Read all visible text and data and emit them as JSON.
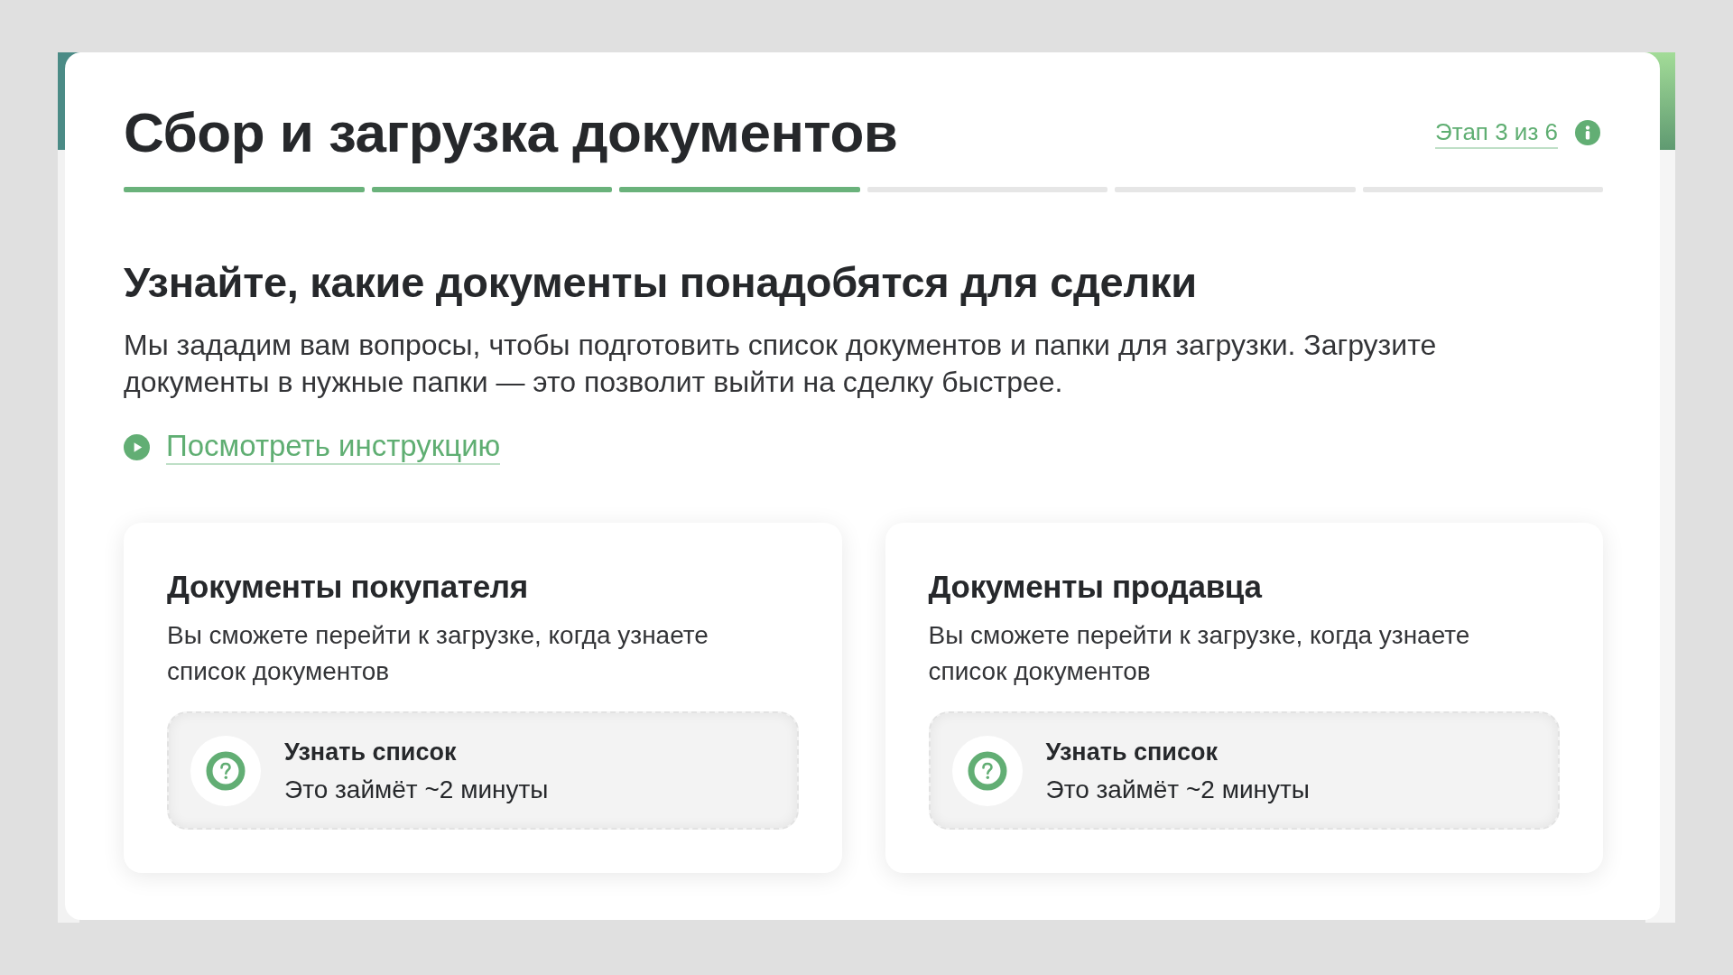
{
  "header": {
    "title": "Сбор и загрузка документов",
    "step_link": "Этап 3 из 6"
  },
  "progress": {
    "steps": [
      {
        "completed": true
      },
      {
        "completed": true
      },
      {
        "completed": true
      },
      {
        "completed": false
      },
      {
        "completed": false
      },
      {
        "completed": false
      }
    ]
  },
  "intro": {
    "heading": "Узнайте, какие документы понадобятся для сделки",
    "text": "Мы зададим вам вопросы, чтобы подготовить список документов и папки для загрузки. Загрузите документы в нужные папки — это позволит выйти на сделку быстрее.",
    "video_link": "Посмотреть инструкцию"
  },
  "cards": [
    {
      "title": "Документы покупателя",
      "text": "Вы сможете перейти к загрузке, когда узнаете список документов",
      "action": {
        "title": "Узнать список",
        "subtitle": "Это займёт ~2 минуты"
      }
    },
    {
      "title": "Документы продавца",
      "text": "Вы сможете перейти к загрузке, когда узнаете список документов",
      "action": {
        "title": "Узнать список",
        "subtitle": "Это займёт ~2 минуты"
      }
    }
  ]
}
